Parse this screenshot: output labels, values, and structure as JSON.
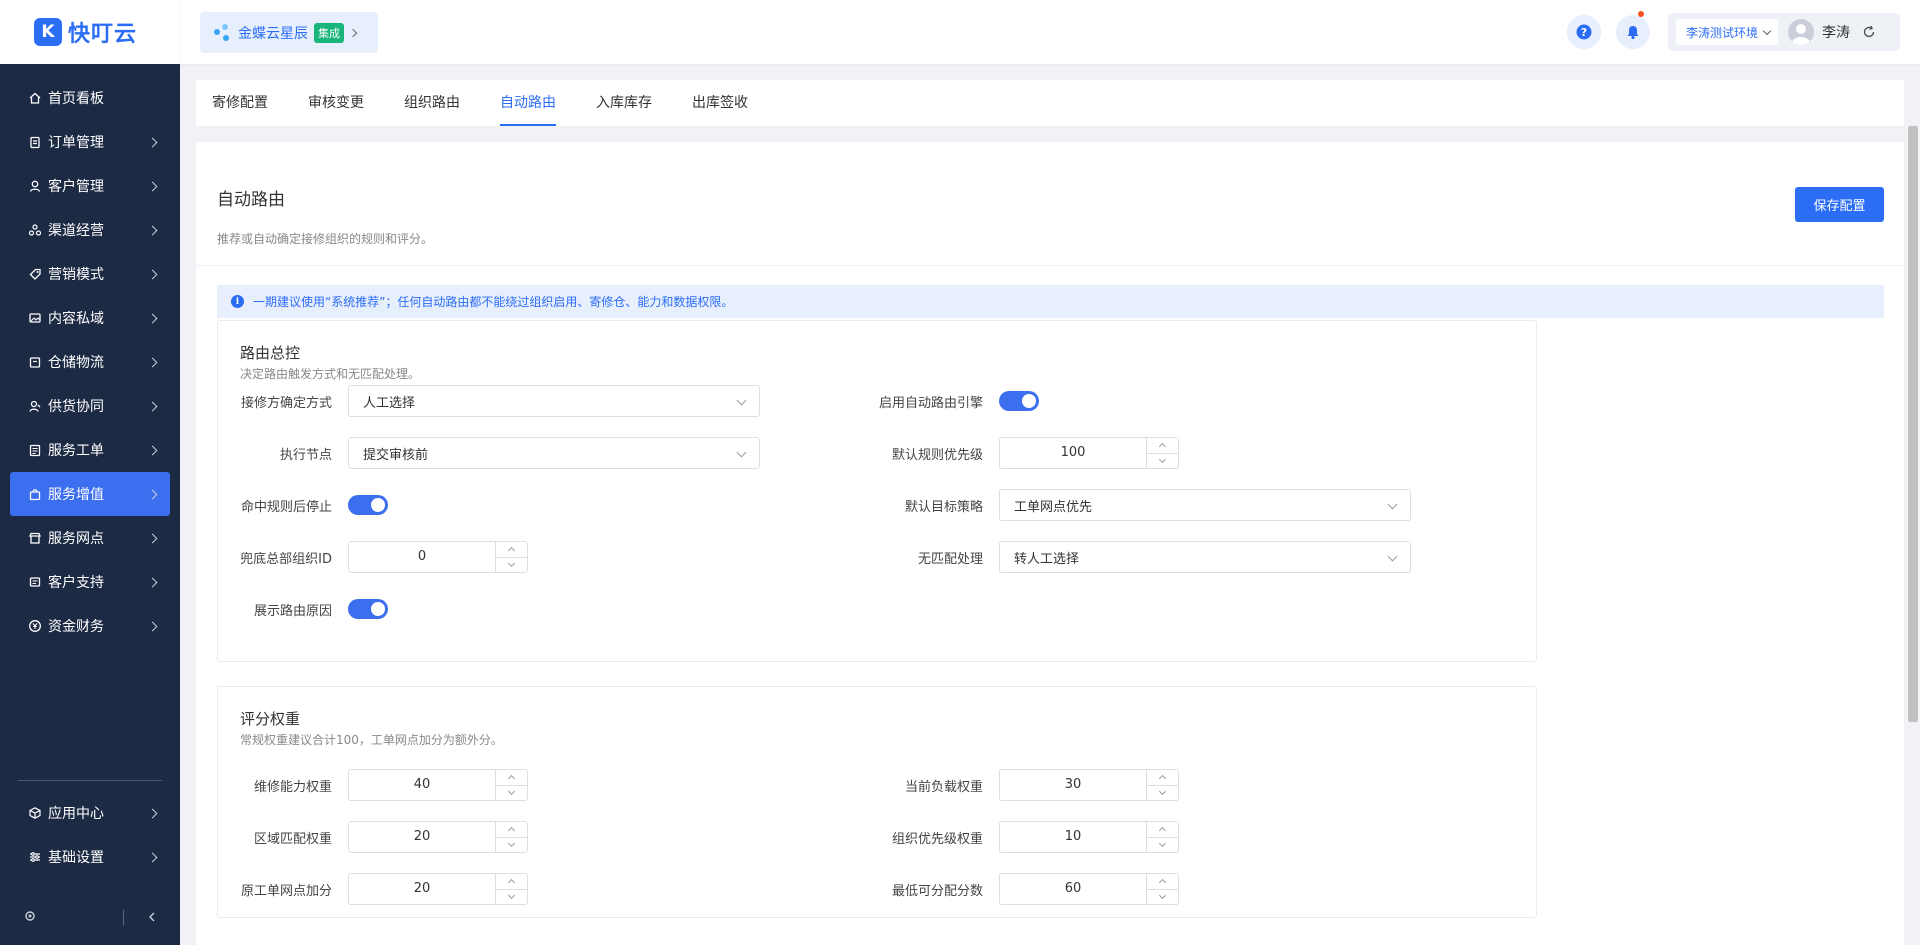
{
  "brand": {
    "logo_mark": "K",
    "name": "快叮云"
  },
  "app_switcher": {
    "name": "金蝶云星辰",
    "badge": "集成"
  },
  "header": {
    "env": "李涛测试环境",
    "user": "李涛",
    "help_icon": "question-circle-icon",
    "bell_icon": "bell-icon",
    "refresh_icon": "refresh-icon"
  },
  "sidebar": {
    "items": [
      {
        "label": "首页看板",
        "icon": "home-icon",
        "chevron": false
      },
      {
        "label": "订单管理",
        "icon": "clipboard-icon",
        "chevron": true
      },
      {
        "label": "客户管理",
        "icon": "user-icon",
        "chevron": true
      },
      {
        "label": "渠道经营",
        "icon": "channel-icon",
        "chevron": true
      },
      {
        "label": "营销模式",
        "icon": "tag-icon",
        "chevron": true
      },
      {
        "label": "内容私域",
        "icon": "image-icon",
        "chevron": true
      },
      {
        "label": "仓储物流",
        "icon": "box-icon",
        "chevron": true
      },
      {
        "label": "供货协同",
        "icon": "supplier-icon",
        "chevron": true
      },
      {
        "label": "服务工单",
        "icon": "workorder-icon",
        "chevron": true
      },
      {
        "label": "服务增值",
        "icon": "bag-icon",
        "chevron": true,
        "active": true
      },
      {
        "label": "服务网点",
        "icon": "store-icon",
        "chevron": true
      },
      {
        "label": "客户支持",
        "icon": "support-icon",
        "chevron": true
      },
      {
        "label": "资金财务",
        "icon": "yen-icon",
        "chevron": true
      }
    ],
    "bottom_items": [
      {
        "label": "应用中心",
        "icon": "cube-icon",
        "chevron": true
      },
      {
        "label": "基础设置",
        "icon": "settings-icon",
        "chevron": true
      }
    ]
  },
  "tabs": [
    {
      "label": "寄修配置"
    },
    {
      "label": "审核变更"
    },
    {
      "label": "组织路由"
    },
    {
      "label": "自动路由",
      "active": true
    },
    {
      "label": "入库库存"
    },
    {
      "label": "出库签收"
    }
  ],
  "page": {
    "title": "自动路由",
    "desc": "推荐或自动确定接修组织的规则和评分。",
    "save_label": "保存配置",
    "alert": "一期建议使用“系统推荐”；任何自动路由都不能绕过组织启用、寄修仓、能力和数据权限。"
  },
  "routing": {
    "title": "路由总控",
    "desc": "决定路由触发方式和无匹配处理。",
    "repairer_mode": {
      "label": "接修方确定方式",
      "value": "人工选择"
    },
    "exec_node": {
      "label": "执行节点",
      "value": "提交审核前"
    },
    "stop_on_hit": {
      "label": "命中规则后停止",
      "on": true
    },
    "fallback_org": {
      "label": "兜底总部组织ID",
      "value": "0"
    },
    "show_reason": {
      "label": "展示路由原因",
      "on": true
    },
    "enable_engine": {
      "label": "启用自动路由引擎",
      "on": true
    },
    "default_priority": {
      "label": "默认规则优先级",
      "value": "100"
    },
    "default_target": {
      "label": "默认目标策略",
      "value": "工单网点优先"
    },
    "no_match": {
      "label": "无匹配处理",
      "value": "转人工选择"
    }
  },
  "weights": {
    "title": "评分权重",
    "desc": "常规权重建议合计100，工单网点加分为额外分。",
    "capability": {
      "label": "维修能力权重",
      "value": "40"
    },
    "region": {
      "label": "区域匹配权重",
      "value": "20"
    },
    "origin_bonus": {
      "label": "原工单网点加分",
      "value": "20"
    },
    "load": {
      "label": "当前负载权重",
      "value": "30"
    },
    "org_priority": {
      "label": "组织优先级权重",
      "value": "10"
    },
    "min_score": {
      "label": "最低可分配分数",
      "value": "60"
    }
  },
  "colors": {
    "primary": "#2c6df6",
    "sidebar_bg": "#1c2a44",
    "badge_green": "#19b57a"
  }
}
